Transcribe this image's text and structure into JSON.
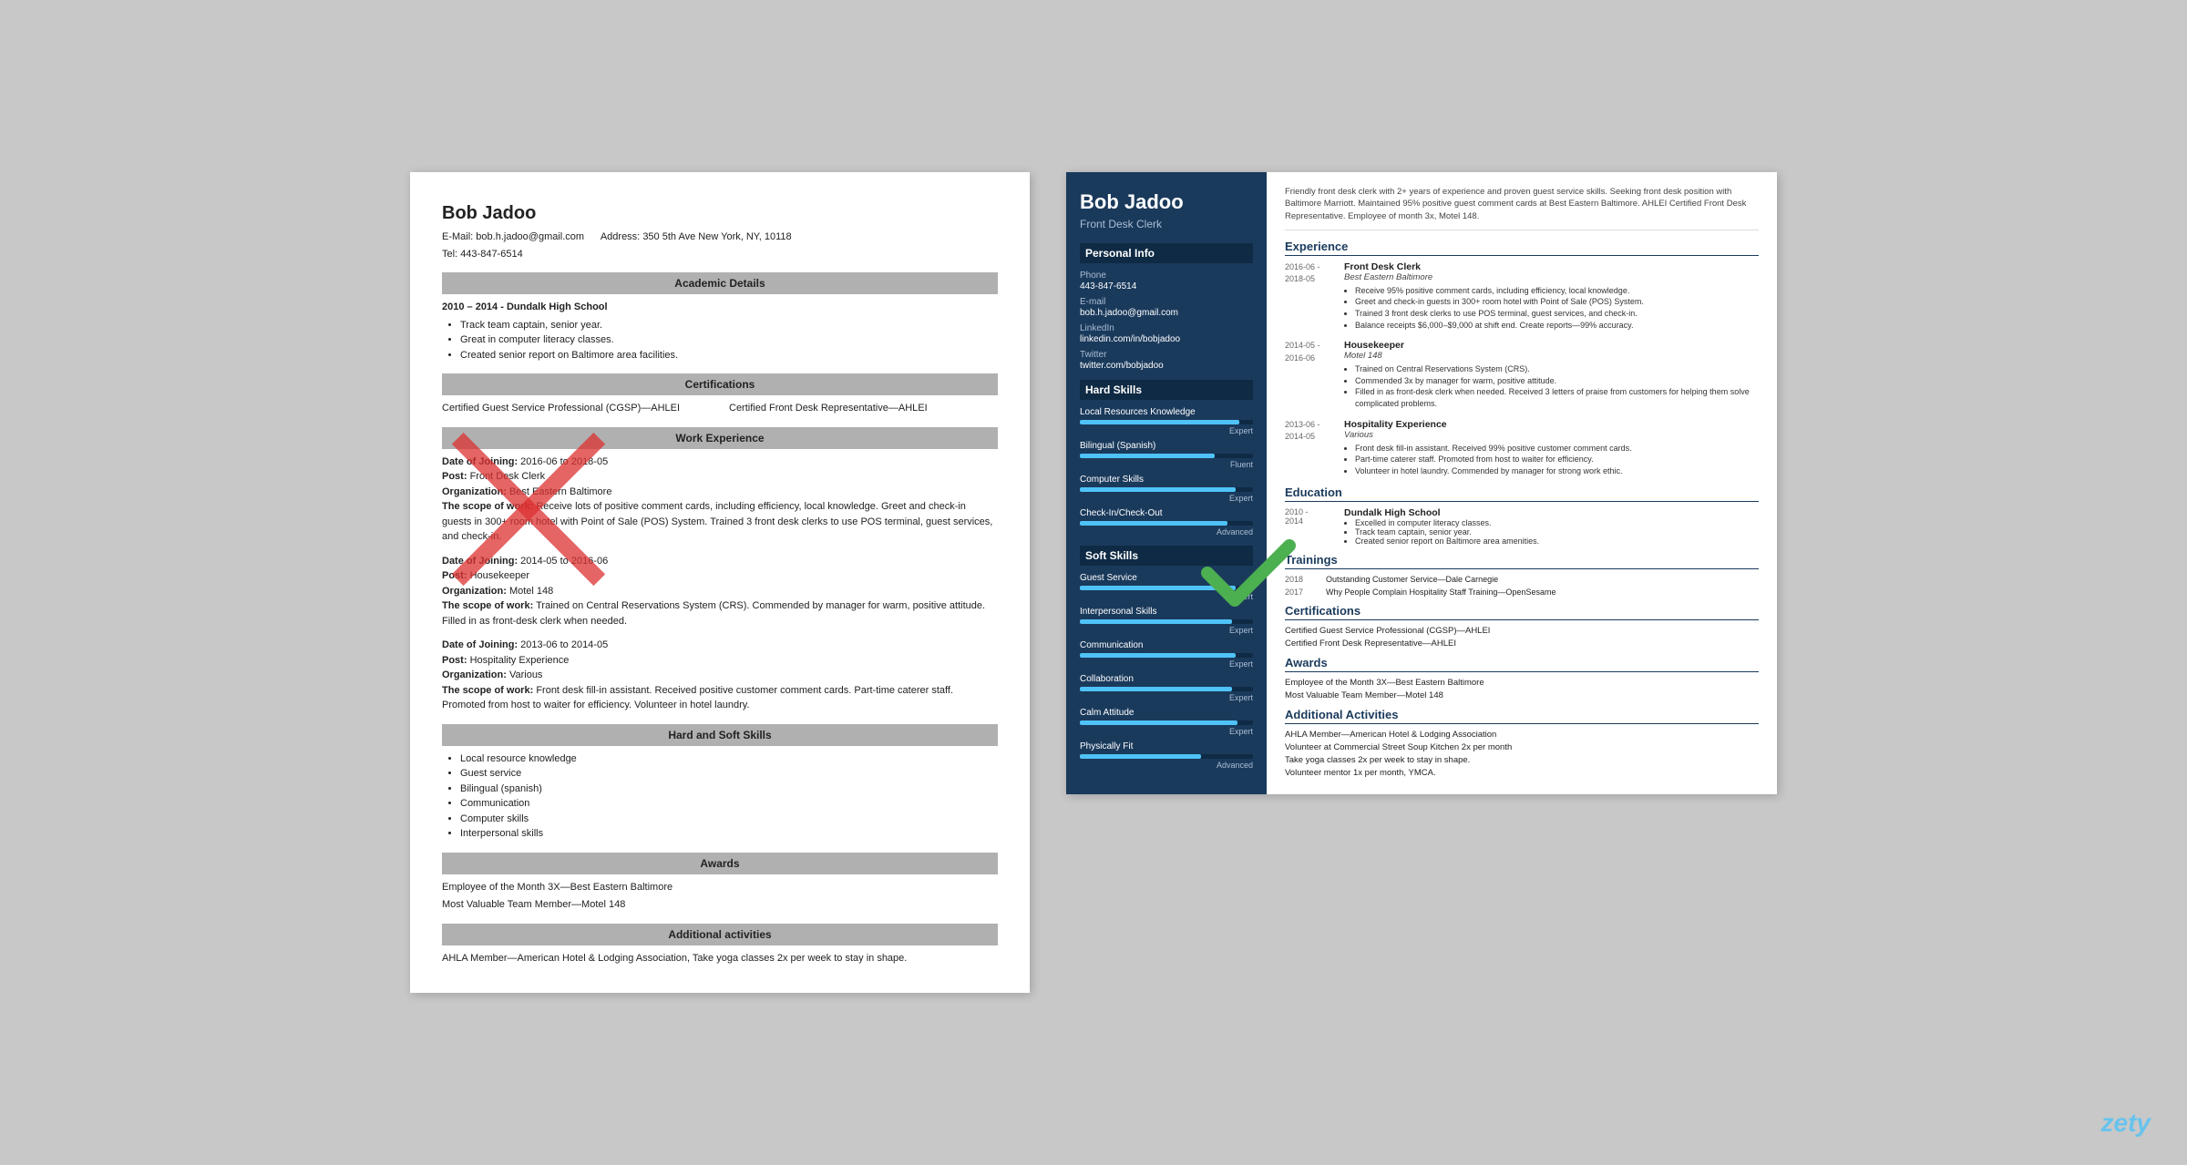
{
  "leftResume": {
    "name": "Bob Jadoo",
    "email_label": "E-Mail:",
    "email": "bob.h.jadoo@gmail.com",
    "address_label": "Address:",
    "address": "350 5th Ave New York, NY, 10118",
    "tel_label": "Tel:",
    "tel": "443-847-6514",
    "sections": {
      "academic": "Academic Details",
      "academic_entry": "2010 – 2014 - Dundalk High School",
      "academic_bullets": [
        "Track team captain, senior year.",
        "Great in computer literacy classes.",
        "Created senior report on Baltimore area facilities."
      ],
      "certifications": "Certifications",
      "cert1": "Certified Guest Service Professional (CGSP)—AHLEI",
      "cert2": "Certified Front Desk Representative—AHLEI",
      "work": "Work Experience",
      "work_entries": [
        {
          "date_label": "Date of Joining:",
          "date": "2016-06 to 2018-05",
          "post_label": "Post:",
          "post": "Front Desk Clerk",
          "org_label": "Organization:",
          "org": "Best Eastern Baltimore",
          "scope_label": "The scope of work:",
          "scope": "Receive lots of positive comment cards, including efficiency, local knowledge. Greet and check-in guests in 300+ room hotel with Point of Sale (POS) System. Trained 3 front desk clerks to use POS terminal, guest services, and check-in."
        },
        {
          "date_label": "Date of Joining:",
          "date": "2014-05 to 2016-06",
          "post_label": "Post:",
          "post": "Housekeeper",
          "org_label": "Organization:",
          "org": "Motel 148",
          "scope_label": "The scope of work:",
          "scope": "Trained on Central Reservations System (CRS). Commended by manager for warm, positive attitude. Filled in as front-desk clerk when needed."
        },
        {
          "date_label": "Date of Joining:",
          "date": "2013-06 to 2014-05",
          "post_label": "Post:",
          "post": "Hospitality Experience",
          "org_label": "Organization:",
          "org": "Various",
          "scope_label": "The scope of work:",
          "scope": "Front desk fill-in assistant. Received positive customer comment cards. Part-time caterer staff. Promoted from host to waiter for efficiency. Volunteer in hotel laundry."
        }
      ],
      "skills": "Hard and Soft Skills",
      "skills_list": [
        "Local resource knowledge",
        "Guest service",
        "Bilingual (spanish)",
        "Communication",
        "Computer skills",
        "Interpersonal skills"
      ],
      "awards": "Awards",
      "awards_list": [
        "Employee of the Month 3X—Best Eastern Baltimore",
        "Most Valuable Team Member—Motel 148"
      ],
      "additional": "Additional activities",
      "additional_text": "AHLA Member—American Hotel & Lodging Association, Take yoga classes 2x per week to stay in shape."
    }
  },
  "rightResume": {
    "name": "Bob Jadoo",
    "title": "Front Desk Clerk",
    "summary": "Friendly front desk clerk with 2+ years of experience and proven guest service skills. Seeking front desk position with Baltimore Marriott. Maintained 95% positive guest comment cards at Best Eastern Baltimore. AHLEI Certified Front Desk Representative. Employee of month 3x, Motel 148.",
    "sidebar": {
      "personal_info": "Personal Info",
      "phone_label": "Phone",
      "phone": "443-847-6514",
      "email_label": "E-mail",
      "email": "bob.h.jadoo@gmail.com",
      "linkedin_label": "LinkedIn",
      "linkedin": "linkedin.com/in/bobjadoo",
      "twitter_label": "Twitter",
      "twitter": "twitter.com/bobjadoo",
      "hard_skills": "Hard Skills",
      "soft_skills": "Soft Skills",
      "skills": [
        {
          "name": "Local Resources Knowledge",
          "fill": 92,
          "level": "Expert"
        },
        {
          "name": "Bilingual (Spanish)",
          "fill": 78,
          "level": "Fluent"
        },
        {
          "name": "Computer Skills",
          "fill": 90,
          "level": "Expert"
        },
        {
          "name": "Check-In/Check-Out",
          "fill": 85,
          "level": "Advanced"
        },
        {
          "name": "Guest Service",
          "fill": 90,
          "level": "Expert"
        },
        {
          "name": "Interpersonal Skills",
          "fill": 88,
          "level": "Expert"
        },
        {
          "name": "Communication",
          "fill": 90,
          "level": "Expert"
        },
        {
          "name": "Collaboration",
          "fill": 88,
          "level": "Expert"
        },
        {
          "name": "Calm Attitude",
          "fill": 91,
          "level": "Expert"
        },
        {
          "name": "Physically Fit",
          "fill": 70,
          "level": "Advanced"
        }
      ]
    },
    "experience_title": "Experience",
    "experience": [
      {
        "start": "2016-06 -",
        "end": "2018-05",
        "title": "Front Desk Clerk",
        "company": "Best Eastern Baltimore",
        "bullets": [
          "Receive 95% positive comment cards, including efficiency, local knowledge.",
          "Greet and check-in guests in 300+ room hotel with Point of Sale (POS) System.",
          "Trained 3 front desk clerks to use POS terminal, guest services, and check-in.",
          "Balance receipts $6,000–$9,000 at shift end. Create reports—99% accuracy."
        ]
      },
      {
        "start": "2014-05 -",
        "end": "2016-06",
        "title": "Housekeeper",
        "company": "Motel 148",
        "bullets": [
          "Trained on Central Reservations System (CRS).",
          "Commended 3x by manager for warm, positive attitude.",
          "Filled in as front-desk clerk when needed. Received 3 letters of praise from customers for helping them solve complicated problems."
        ]
      },
      {
        "start": "2013-06 -",
        "end": "2014-05",
        "title": "Hospitality Experience",
        "company": "Various",
        "bullets": [
          "Front desk fill-in assistant. Received 99% positive customer comment cards.",
          "Part-time caterer staff. Promoted from host to waiter for efficiency.",
          "Volunteer in hotel laundry. Commended by manager for strong work ethic."
        ]
      }
    ],
    "education_title": "Education",
    "education": [
      {
        "start": "2010 -",
        "end": "2014",
        "school": "Dundalk High School",
        "bullets": [
          "Excelled in computer literacy classes.",
          "Track team captain, senior year.",
          "Created senior report on Baltimore area amenities."
        ]
      }
    ],
    "trainings_title": "Trainings",
    "trainings": [
      {
        "year": "2018",
        "name": "Outstanding Customer Service—Dale Carnegie"
      },
      {
        "year": "2017",
        "name": "Why People Complain Hospitality Staff Training—OpenSesame"
      }
    ],
    "certifications_title": "Certifications",
    "certifications": [
      "Certified Guest Service Professional (CGSP)—AHLEI",
      "Certified Front Desk Representative—AHLEI"
    ],
    "awards_title": "Awards",
    "awards": [
      "Employee of the Month 3X—Best Eastern Baltimore",
      "Most Valuable Team Member—Motel 148"
    ],
    "additional_title": "Additional Activities",
    "additional": [
      "AHLA Member—American Hotel & Lodging Association",
      "Volunteer at Commercial Street Soup Kitchen 2x per month",
      "Take yoga classes 2x per week to stay in shape.",
      "Volunteer mentor 1x per month, YMCA."
    ]
  },
  "watermark": "zety"
}
